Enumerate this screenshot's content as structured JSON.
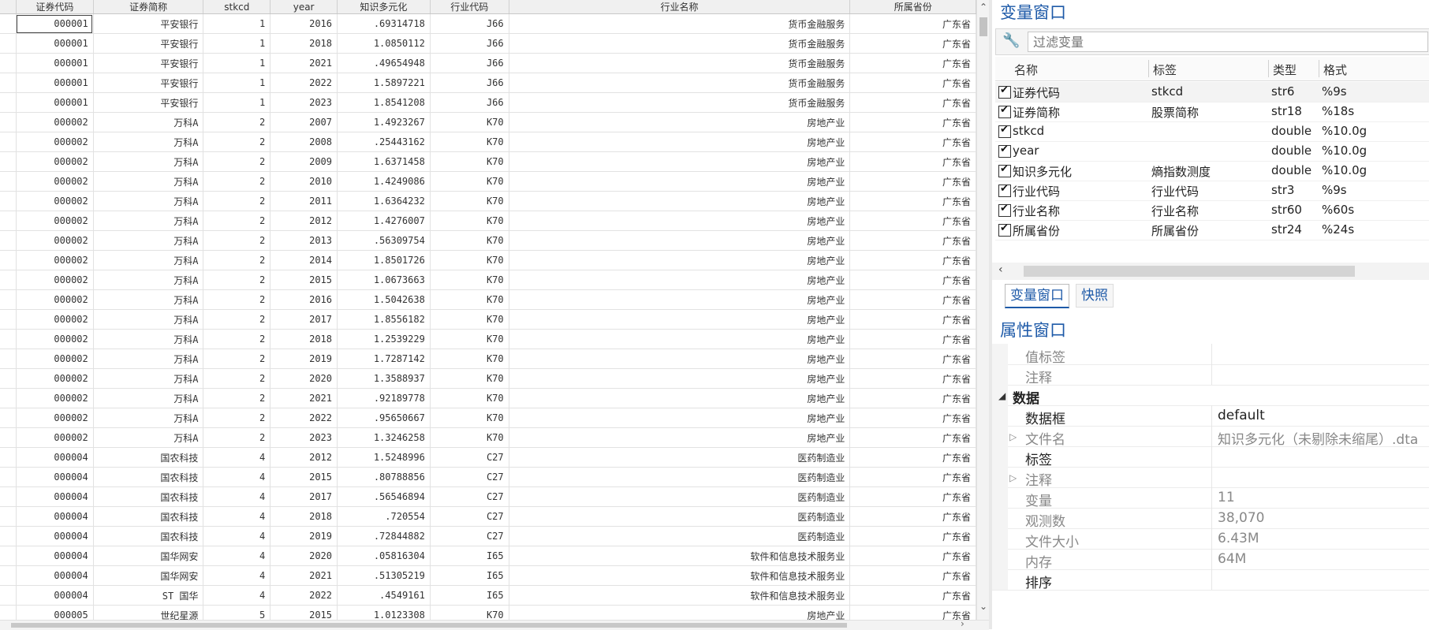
{
  "grid": {
    "columns": [
      "证券代码",
      "证券简称",
      "stkcd",
      "year",
      "知识多元化",
      "行业代码",
      "行业名称",
      "所属省份"
    ],
    "rows": [
      [
        "000001",
        "平安银行",
        "1",
        "2016",
        ".69314718",
        "J66",
        "货币金融服务",
        "广东省"
      ],
      [
        "000001",
        "平安银行",
        "1",
        "2018",
        "1.0850112",
        "J66",
        "货币金融服务",
        "广东省"
      ],
      [
        "000001",
        "平安银行",
        "1",
        "2021",
        ".49654948",
        "J66",
        "货币金融服务",
        "广东省"
      ],
      [
        "000001",
        "平安银行",
        "1",
        "2022",
        "1.5897221",
        "J66",
        "货币金融服务",
        "广东省"
      ],
      [
        "000001",
        "平安银行",
        "1",
        "2023",
        "1.8541208",
        "J66",
        "货币金融服务",
        "广东省"
      ],
      [
        "000002",
        "万科A",
        "2",
        "2007",
        "1.4923267",
        "K70",
        "房地产业",
        "广东省"
      ],
      [
        "000002",
        "万科A",
        "2",
        "2008",
        ".25443162",
        "K70",
        "房地产业",
        "广东省"
      ],
      [
        "000002",
        "万科A",
        "2",
        "2009",
        "1.6371458",
        "K70",
        "房地产业",
        "广东省"
      ],
      [
        "000002",
        "万科A",
        "2",
        "2010",
        "1.4249086",
        "K70",
        "房地产业",
        "广东省"
      ],
      [
        "000002",
        "万科A",
        "2",
        "2011",
        "1.6364232",
        "K70",
        "房地产业",
        "广东省"
      ],
      [
        "000002",
        "万科A",
        "2",
        "2012",
        "1.4276007",
        "K70",
        "房地产业",
        "广东省"
      ],
      [
        "000002",
        "万科A",
        "2",
        "2013",
        ".56309754",
        "K70",
        "房地产业",
        "广东省"
      ],
      [
        "000002",
        "万科A",
        "2",
        "2014",
        "1.8501726",
        "K70",
        "房地产业",
        "广东省"
      ],
      [
        "000002",
        "万科A",
        "2",
        "2015",
        "1.0673663",
        "K70",
        "房地产业",
        "广东省"
      ],
      [
        "000002",
        "万科A",
        "2",
        "2016",
        "1.5042638",
        "K70",
        "房地产业",
        "广东省"
      ],
      [
        "000002",
        "万科A",
        "2",
        "2017",
        "1.8556182",
        "K70",
        "房地产业",
        "广东省"
      ],
      [
        "000002",
        "万科A",
        "2",
        "2018",
        "1.2539229",
        "K70",
        "房地产业",
        "广东省"
      ],
      [
        "000002",
        "万科A",
        "2",
        "2019",
        "1.7287142",
        "K70",
        "房地产业",
        "广东省"
      ],
      [
        "000002",
        "万科A",
        "2",
        "2020",
        "1.3588937",
        "K70",
        "房地产业",
        "广东省"
      ],
      [
        "000002",
        "万科A",
        "2",
        "2021",
        ".92189778",
        "K70",
        "房地产业",
        "广东省"
      ],
      [
        "000002",
        "万科A",
        "2",
        "2022",
        ".95650667",
        "K70",
        "房地产业",
        "广东省"
      ],
      [
        "000002",
        "万科A",
        "2",
        "2023",
        "1.3246258",
        "K70",
        "房地产业",
        "广东省"
      ],
      [
        "000004",
        "国农科技",
        "4",
        "2012",
        "1.5248996",
        "C27",
        "医药制造业",
        "广东省"
      ],
      [
        "000004",
        "国农科技",
        "4",
        "2015",
        ".80788856",
        "C27",
        "医药制造业",
        "广东省"
      ],
      [
        "000004",
        "国农科技",
        "4",
        "2017",
        ".56546894",
        "C27",
        "医药制造业",
        "广东省"
      ],
      [
        "000004",
        "国农科技",
        "4",
        "2018",
        ".720554",
        "C27",
        "医药制造业",
        "广东省"
      ],
      [
        "000004",
        "国农科技",
        "4",
        "2019",
        ".72844882",
        "C27",
        "医药制造业",
        "广东省"
      ],
      [
        "000004",
        "国华网安",
        "4",
        "2020",
        ".05816304",
        "I65",
        "软件和信息技术服务业",
        "广东省"
      ],
      [
        "000004",
        "国华网安",
        "4",
        "2021",
        ".51305219",
        "I65",
        "软件和信息技术服务业",
        "广东省"
      ],
      [
        "000004",
        "ST 国华",
        "4",
        "2022",
        ".4549161",
        "I65",
        "软件和信息技术服务业",
        "广东省"
      ],
      [
        "000005",
        "世纪星源",
        "5",
        "2015",
        "1.0123308",
        "K70",
        "房地产业",
        "广东省"
      ]
    ]
  },
  "var_window": {
    "title": "变量窗口",
    "filter_placeholder": "过滤变量",
    "headers": {
      "name": "名称",
      "label": "标签",
      "type": "类型",
      "format": "格式"
    },
    "variables": [
      {
        "name": "证券代码",
        "label": "stkcd",
        "type": "str6",
        "format": "%9s"
      },
      {
        "name": "证券简称",
        "label": "股票简称",
        "type": "str18",
        "format": "%18s"
      },
      {
        "name": "stkcd",
        "label": "",
        "type": "double",
        "format": "%10.0g"
      },
      {
        "name": "year",
        "label": "",
        "type": "double",
        "format": "%10.0g"
      },
      {
        "name": "知识多元化",
        "label": "熵指数测度",
        "type": "double",
        "format": "%10.0g"
      },
      {
        "name": "行业代码",
        "label": "行业代码",
        "type": "str3",
        "format": "%9s"
      },
      {
        "name": "行业名称",
        "label": "行业名称",
        "type": "str60",
        "format": "%60s"
      },
      {
        "name": "所属省份",
        "label": "所属省份",
        "type": "str24",
        "format": "%24s"
      }
    ],
    "tabs": [
      "变量窗口",
      "快照"
    ]
  },
  "prop_window": {
    "title": "属性窗口",
    "rows": [
      {
        "key": "值标签",
        "value": "",
        "kind": "muted"
      },
      {
        "key": "注释",
        "value": "",
        "kind": "muted"
      },
      {
        "key": "数据",
        "value": "",
        "kind": "section"
      },
      {
        "key": "数据框",
        "value": "default",
        "kind": "dark"
      },
      {
        "key": "文件名",
        "value": "知识多元化（未剔除未缩尾）.dta",
        "kind": "expand"
      },
      {
        "key": "标签",
        "value": "",
        "kind": "dark"
      },
      {
        "key": "注释",
        "value": "",
        "kind": "expand"
      },
      {
        "key": "变量",
        "value": "11",
        "kind": "muted"
      },
      {
        "key": "观测数",
        "value": "38,070",
        "kind": "muted"
      },
      {
        "key": "文件大小",
        "value": "6.43M",
        "kind": "muted"
      },
      {
        "key": "内存",
        "value": "64M",
        "kind": "muted"
      },
      {
        "key": "排序",
        "value": "",
        "kind": "dark"
      }
    ]
  },
  "icons": {
    "filter": "wrench-icon",
    "scroll_up": "chevron-up-icon",
    "scroll_down": "chevron-down-icon",
    "scroll_left": "chevron-left-icon",
    "scroll_right": "chevron-right-icon"
  }
}
